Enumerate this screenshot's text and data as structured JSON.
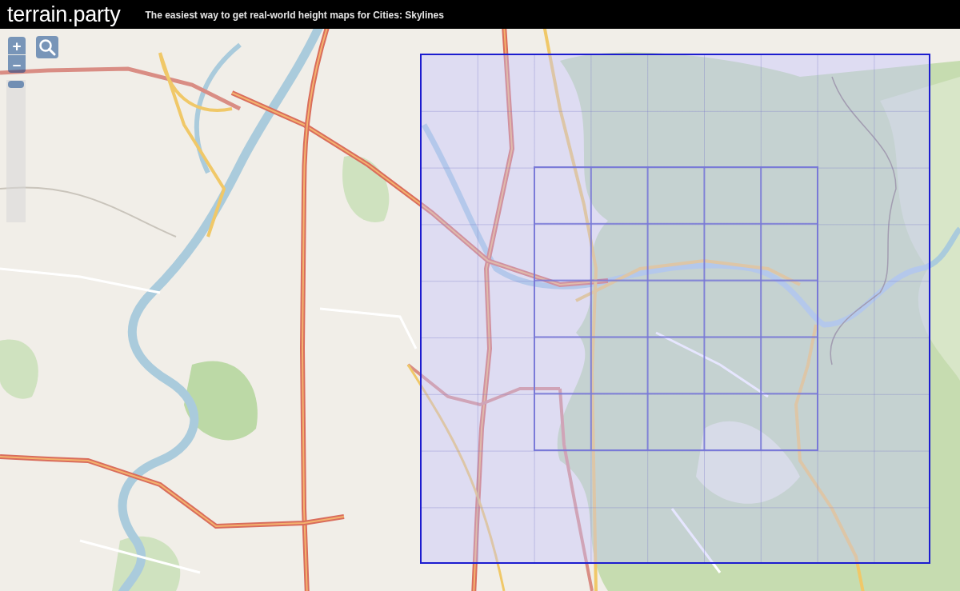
{
  "header": {
    "title": "terrain.party",
    "tagline": "The easiest way to get real-world height maps for Cities: Skylines"
  },
  "map_controls": {
    "zoom_in": "+",
    "zoom_out": "–",
    "zoom_slider": {
      "level": 1
    }
  }
}
